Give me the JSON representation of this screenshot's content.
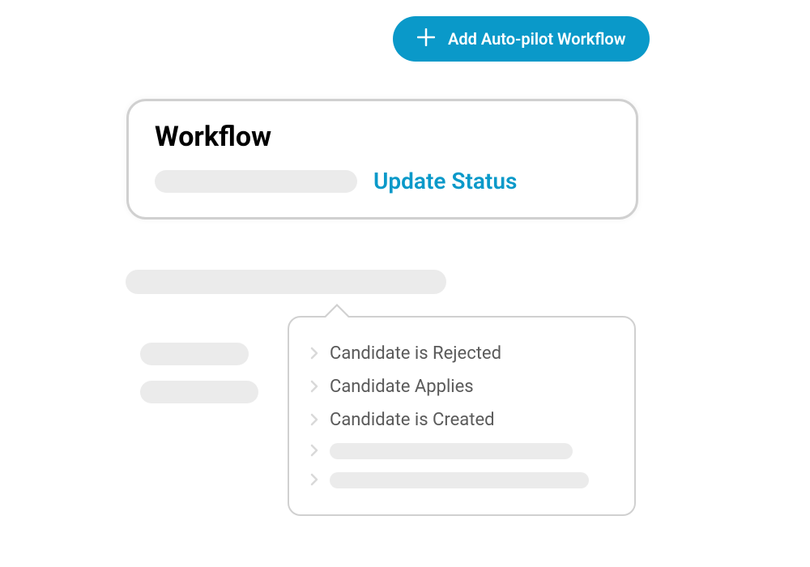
{
  "addButton": {
    "label": "Add Auto-pilot Workflow"
  },
  "workflowCard": {
    "title": "Workflow",
    "actionLabel": "Update Status"
  },
  "dropdown": {
    "items": [
      {
        "label": "Candidate is Rejected"
      },
      {
        "label": "Candidate Applies"
      },
      {
        "label": "Candidate is Created"
      }
    ]
  }
}
